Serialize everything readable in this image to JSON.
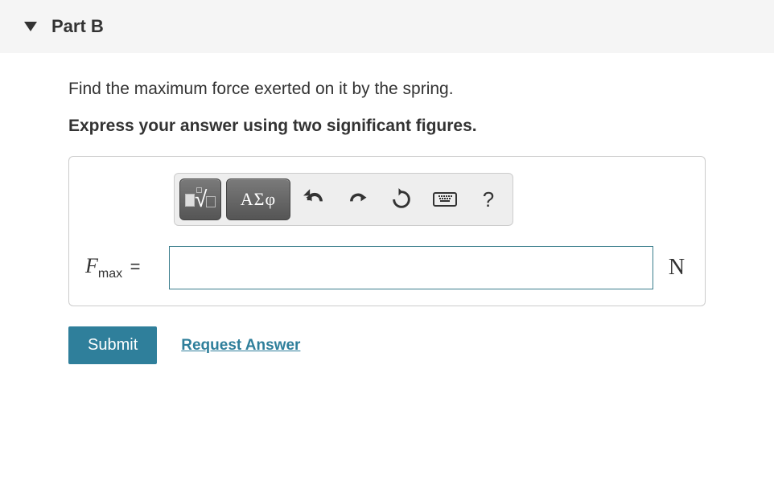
{
  "header": {
    "title": "Part B"
  },
  "question": {
    "text": "Find the maximum force exerted on it by the spring.",
    "instruction": "Express your answer using two significant figures."
  },
  "toolbar": {
    "templates_label": "templates",
    "greek_label": "ΑΣφ"
  },
  "answer": {
    "var_base": "F",
    "var_sub": "max",
    "equals": "=",
    "value": "",
    "unit": "N"
  },
  "actions": {
    "submit": "Submit",
    "request": "Request Answer"
  }
}
